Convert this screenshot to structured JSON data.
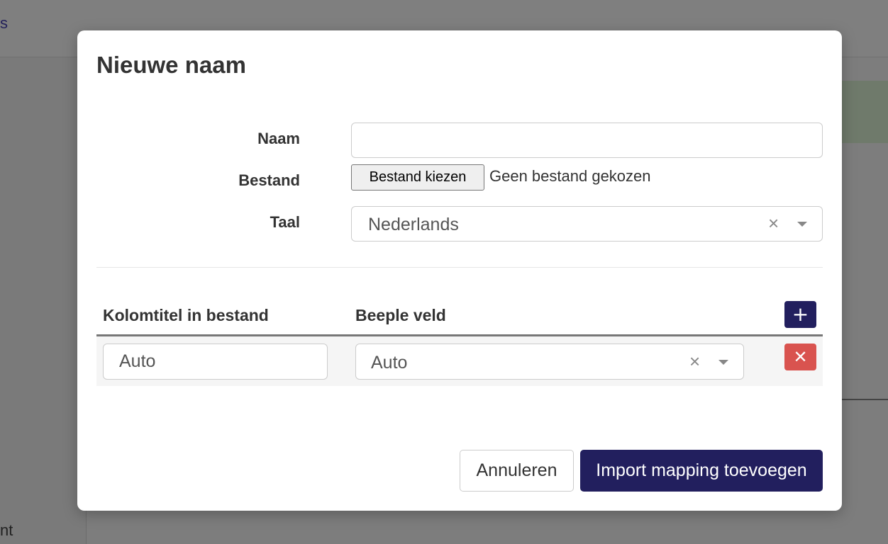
{
  "background": {
    "header_text": "s",
    "sidebar_text": "nt"
  },
  "modal": {
    "title": "Nieuwe naam",
    "form": {
      "naam_label": "Naam",
      "naam_value": "",
      "bestand_label": "Bestand",
      "file_button": "Bestand kiezen",
      "file_status": "Geen bestand gekozen",
      "taal_label": "Taal",
      "taal_value": "Nederlands"
    },
    "table": {
      "col1": "Kolomtitel in bestand",
      "col2": "Beeple veld",
      "add_symbol": "+",
      "rows": [
        {
          "kolomtitel": "Auto",
          "beeple_veld": "Auto",
          "delete_symbol": "✕"
        }
      ]
    },
    "footer": {
      "cancel": "Annuleren",
      "submit": "Import mapping toevoegen"
    }
  },
  "colors": {
    "primary": "#221f5e",
    "danger": "#d9534f",
    "overlay": "#7b7b7b"
  },
  "icons": {
    "clear": "×",
    "caret": "chevron-down-icon"
  }
}
